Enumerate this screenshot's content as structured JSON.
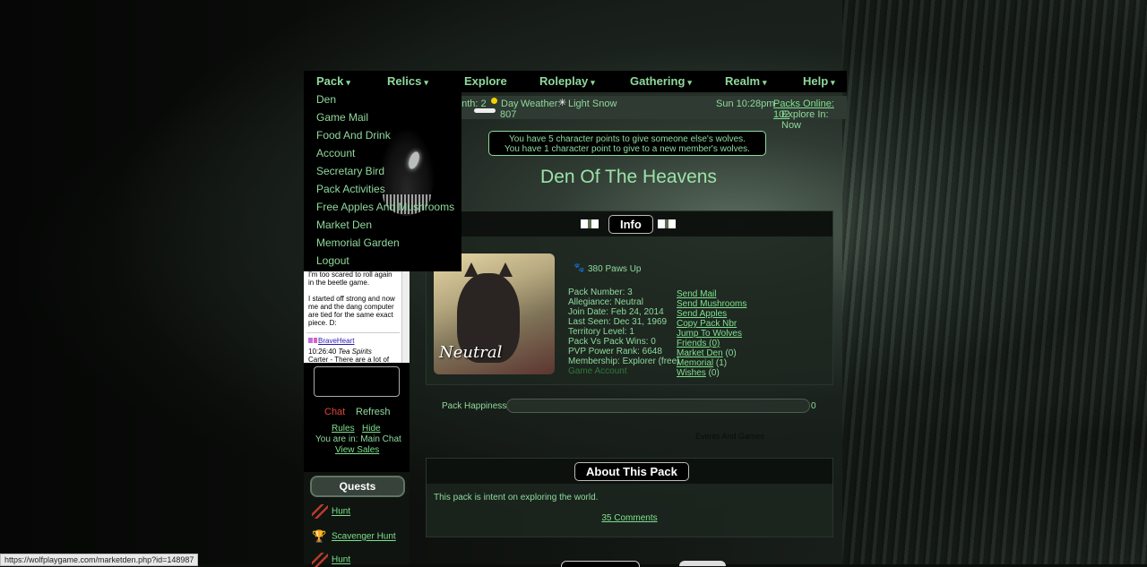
{
  "nav": {
    "items": [
      {
        "label": "Pack",
        "caret": "▾"
      },
      {
        "label": "Relics",
        "caret": "▾"
      },
      {
        "label": "Explore",
        "caret": ""
      },
      {
        "label": "Roleplay",
        "caret": "▾"
      },
      {
        "label": "Gathering",
        "caret": "▾"
      },
      {
        "label": "Realm",
        "caret": "▾"
      },
      {
        "label": "Help",
        "caret": "▾"
      }
    ]
  },
  "dropdown": {
    "items": [
      "Den",
      "Game Mail",
      "Food And Drink",
      "Account",
      "Secretary Bird",
      "Pack Activities",
      "Free Apples And Mushrooms",
      "Market Den",
      "Memorial Garden",
      "Logout"
    ]
  },
  "infobar": {
    "month": "onth: 2",
    "day": "Day",
    "weather_label": "Weather:",
    "weather": "Light Snow",
    "bones": "807",
    "time": "Sun 10:28pm",
    "packs_online": "Packs Online: 102",
    "explore": "Explore In: Now"
  },
  "notice": {
    "line1": "You have 5 character points to give someone else's wolves.",
    "line2": "You have 1 character point to give to a new member's wolves."
  },
  "pack": {
    "title": "Den Of The Heavens",
    "info_tab": "Info",
    "portrait_label": "Neutral",
    "paws": "380 Paws Up",
    "stats": [
      "Pack Number: 3",
      "Allegiance: Neutral",
      "Join Date: Feb 24, 2014",
      "Last Seen: Dec 31, 1969",
      "Territory Level: 1",
      "Pack Vs Pack Wins: 0",
      "PVP Power Rank: 6648",
      "Membership: Explorer (free)"
    ],
    "game_account": "Game Account",
    "links": [
      {
        "text": "Send Mail",
        "extra": ""
      },
      {
        "text": "Send Mushrooms",
        "extra": ""
      },
      {
        "text": "Send Apples",
        "extra": ""
      },
      {
        "text": "Copy Pack Nbr",
        "extra": ""
      },
      {
        "text": "Jump To Wolves",
        "extra": ""
      },
      {
        "text": "Friends",
        "extra": "(0)"
      },
      {
        "text": "Market Den",
        "extra": " (0)"
      },
      {
        "text": "Memorial",
        "extra": " (1)"
      },
      {
        "text": "Wishes",
        "extra": " (0)"
      }
    ],
    "happiness_label": "Pack Happiness",
    "happiness_value": "0",
    "happiness_fraction": 0,
    "events": "Events And Games",
    "about_title": "About This Pack",
    "about_text": "This pack is intent on exploring the world.",
    "comments": "35 Comments"
  },
  "chat": {
    "messages": [
      "I'm too scared to roll again in the beetle game.",
      "I started off strong and now me and the dang computer are tied for the same exact piece. D:"
    ],
    "user": "BraveHeart",
    "timestamp": "10:26:40",
    "room": "Tea Spirits",
    "last_line": "Carter - There are a lot of",
    "chat_label": "Chat",
    "refresh_label": "Refresh",
    "rules": "Rules",
    "hide": "Hide",
    "location": "You are in: Main Chat",
    "view_sales": "View Sales"
  },
  "quests": {
    "title": "Quests",
    "items": [
      "Hunt",
      "Scavenger Hunt",
      "Hunt"
    ]
  },
  "status_url": "https://wolfplaygame.com/marketden.php?id=148987",
  "colors": {
    "accent": "#8fd99c",
    "link": "#7ee08e",
    "chat_red": "#e0443a"
  }
}
